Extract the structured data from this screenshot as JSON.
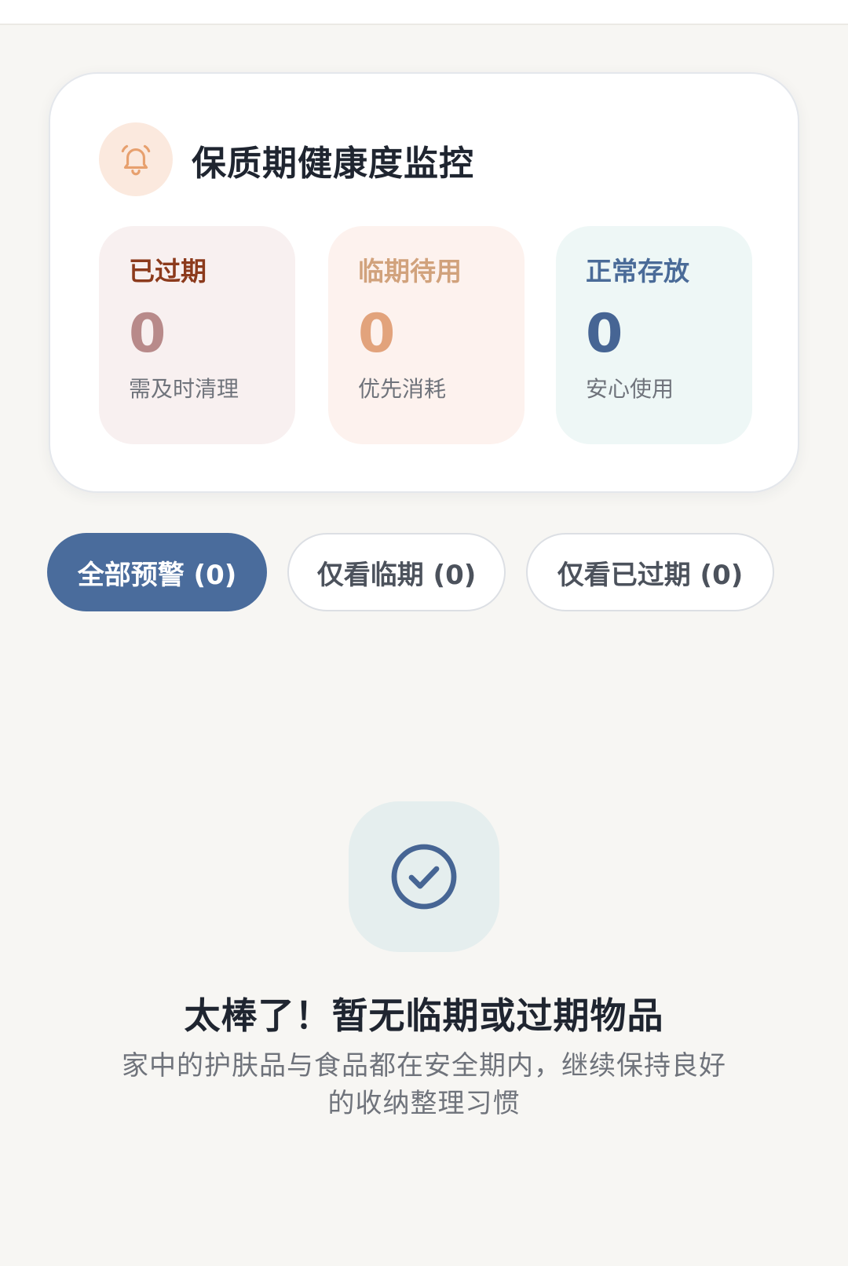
{
  "monitor": {
    "title": "保质期健康度监控",
    "icon": "bell-icon",
    "stats": [
      {
        "label": "已过期",
        "count": "0",
        "sub": "需及时清理"
      },
      {
        "label": "临期待用",
        "count": "0",
        "sub": "优先消耗"
      },
      {
        "label": "正常存放",
        "count": "0",
        "sub": "安心使用"
      }
    ]
  },
  "filters": [
    {
      "label": "全部预警 (0)",
      "active": true
    },
    {
      "label": "仅看临期 (0)",
      "active": false
    },
    {
      "label": "仅看已过期 (0)",
      "active": false
    }
  ],
  "empty_state": {
    "icon": "check-circle-icon",
    "title": "太棒了！暂无临期或过期物品",
    "description": "家中的护肤品与食品都在安全期内，继续保持良好的收纳整理习惯"
  },
  "colors": {
    "accent": "#4a6c9c",
    "expired": "#8c3a1c",
    "soon": "#d1a27c",
    "normal": "#4a6b98",
    "bell": "#e7a06e"
  }
}
